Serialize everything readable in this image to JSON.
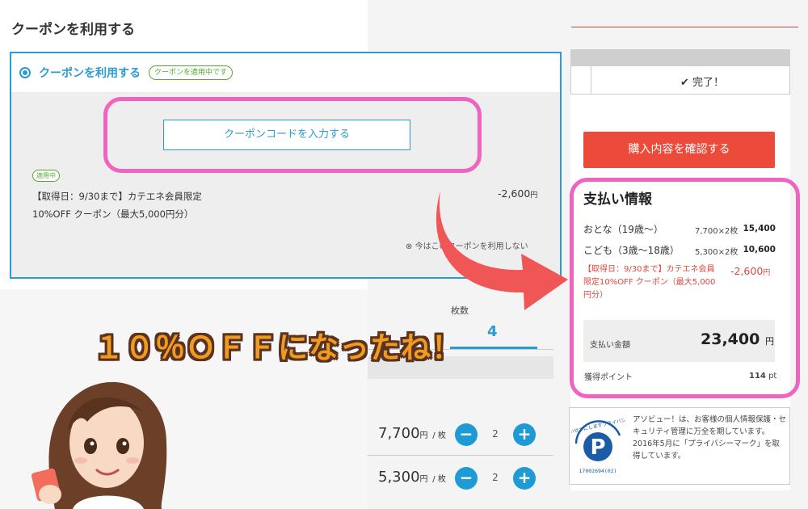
{
  "coupon_section": {
    "title": "クーポンを利用する",
    "radio_label": "クーポンを利用する",
    "applied_badge": "クーポンを適用中です",
    "code_button": "クーポンコードを入力する",
    "status_tag": "適用中",
    "coupon_description": "【取得日：9/30まで】カテエネ会員限定10%OFF クーポン（最大5,000円分）",
    "coupon_amount": "-2,600",
    "coupon_amount_unit": "円",
    "not_use_link": "今はこのクーポンを利用しない"
  },
  "ticket_selection": {
    "count_label": "枚数",
    "count_value": "4",
    "rows": [
      {
        "price": "7,700",
        "unit": "円",
        "per": "/ 枚",
        "quantity": "2",
        "minus": "−",
        "plus": "+"
      },
      {
        "price": "5,300",
        "unit": "円",
        "per": "/ 枚",
        "quantity": "2",
        "minus": "−",
        "plus": "+"
      }
    ]
  },
  "steps": {
    "done_label": "完了！"
  },
  "confirm_button": "購入内容を確認する",
  "payment": {
    "title": "支払い情報",
    "rows": [
      {
        "label": "おとな（19歳〜）",
        "qty": "7,700×2枚",
        "amount": "15,400"
      },
      {
        "label": "こども（3歳〜18歳）",
        "qty": "5,300×2枚",
        "amount": "10,600"
      }
    ],
    "coupon_label": "【取得日：9/30まで】カテエネ会員限定10%OFF クーポン（最大5,000円分）",
    "coupon_amount": "-2,600",
    "coupon_unit": "円",
    "total_label": "支払い金額",
    "total_value": "23,400",
    "total_unit": "円",
    "points_label": "獲得ポイント",
    "points_value": "114",
    "points_unit": "pt"
  },
  "privacy": {
    "text": "アソビュー！は、お客様の個人情報保護・セキュリティ管理に万全を期しています。2016年5月に「プライバシーマーク」を取得しています。",
    "logo_text_top": "たいせつにしますプライバシー",
    "logo_number": "17002694(02)"
  },
  "overlay": {
    "caption": "１０％ＯＦＦになったね！"
  },
  "colors": {
    "accent_blue": "#2b9bd1",
    "highlight_pink": "#ee64c0",
    "confirm_red": "#ec4b3b",
    "discount_red": "#e0463c",
    "arrow_red": "#f05656",
    "caption_orange": "#f09a1f"
  }
}
